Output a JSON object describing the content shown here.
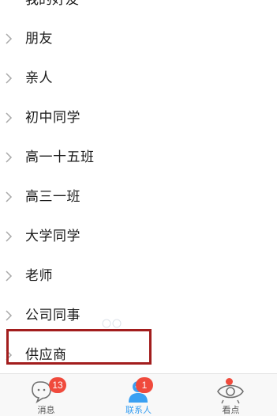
{
  "partial_group": {
    "label": "我的好友"
  },
  "groups": [
    {
      "label": "朋友"
    },
    {
      "label": "亲人"
    },
    {
      "label": "初中同学"
    },
    {
      "label": "高一十五班"
    },
    {
      "label": "高三一班"
    },
    {
      "label": "大学同学"
    },
    {
      "label": "老师"
    },
    {
      "label": "公司同事"
    },
    {
      "label": "供应商"
    }
  ],
  "highlight": {
    "color": "#a21d1d",
    "target": "供应商"
  },
  "tabbar": {
    "tabs": [
      {
        "label": "消息",
        "icon": "message-bubble-icon",
        "badge": "13",
        "active": false
      },
      {
        "label": "联系人",
        "icon": "contacts-person-icon",
        "badge": "1",
        "active": true
      },
      {
        "label": "看点",
        "icon": "eye-icon",
        "badge": "",
        "active": false
      }
    ],
    "active_color": "#3aa0f2",
    "badge_color": "#f04a3c"
  }
}
